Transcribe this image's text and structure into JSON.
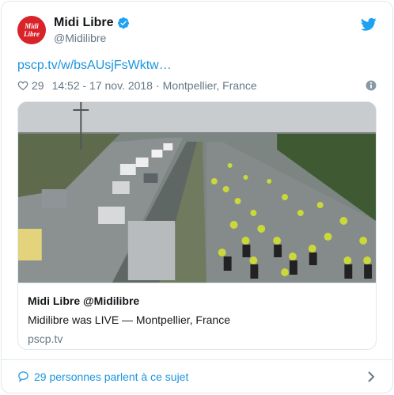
{
  "author": {
    "avatar_line1": "Midi",
    "avatar_line2": "Libre",
    "display_name": "Midi Libre",
    "handle": "@Midilibre"
  },
  "icons": {
    "verified": "verified-badge-icon",
    "bird": "twitter-bird-icon",
    "heart": "heart-icon",
    "info": "info-icon",
    "reply": "speech-bubble-icon",
    "chevron": "chevron-right-icon"
  },
  "colors": {
    "accent": "#1b95e0",
    "brand_red": "#d8232a",
    "muted": "#657786",
    "border": "#e1e8ed"
  },
  "tweet": {
    "link": "pscp.tv/w/bsAUsjFsWktw…",
    "likes": "29",
    "time": "14:52 - 17 nov. 2018",
    "separator": "·",
    "location": "Montpellier, France"
  },
  "card": {
    "title": "Midi Libre @Midilibre",
    "description": "Midilibre was LIVE — Montpellier, France",
    "domain": "pscp.tv"
  },
  "footer": {
    "text": "29 personnes parlent à ce sujet"
  }
}
